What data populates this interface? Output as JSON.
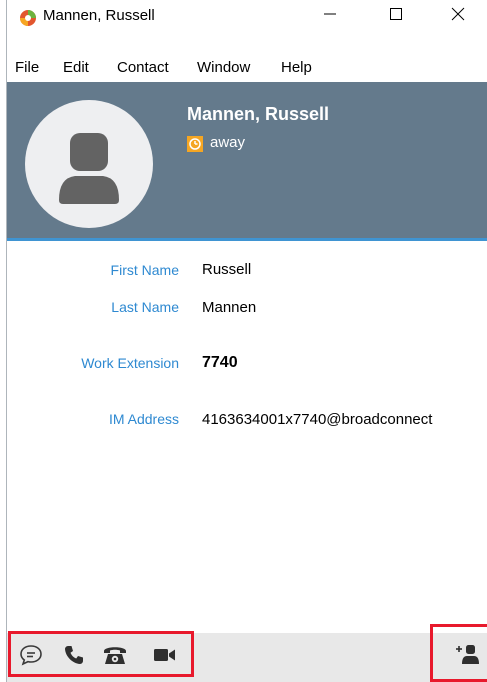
{
  "window": {
    "title": "Mannen, Russell",
    "controls": [
      "minimize-icon",
      "maximize-icon",
      "close-icon"
    ]
  },
  "menu": {
    "items": [
      "File",
      "Edit",
      "Contact",
      "Window",
      "Help"
    ]
  },
  "header": {
    "name": "Mannen, Russell",
    "presence": "away",
    "presence_icon": "away-clock-icon",
    "presence_color": "#f5a623",
    "background_color": "#647a8c",
    "accent_color": "#3f94d2"
  },
  "fields": [
    {
      "label": "First Name",
      "value": "Russell"
    },
    {
      "label": "Last Name",
      "value": "Mannen"
    },
    {
      "label": "Work Extension",
      "value": "7740"
    },
    {
      "label": "IM Address",
      "value": "4163634001x7740@broadconnect"
    }
  ],
  "actions": {
    "left": [
      "chat-icon",
      "phone-icon",
      "desk-phone-icon",
      "video-camera-icon"
    ],
    "right": [
      "add-contact-icon"
    ]
  },
  "colors": {
    "label": "#2e89d1",
    "highlight": "#e8192c",
    "footer_bg": "#e8e8e8"
  }
}
